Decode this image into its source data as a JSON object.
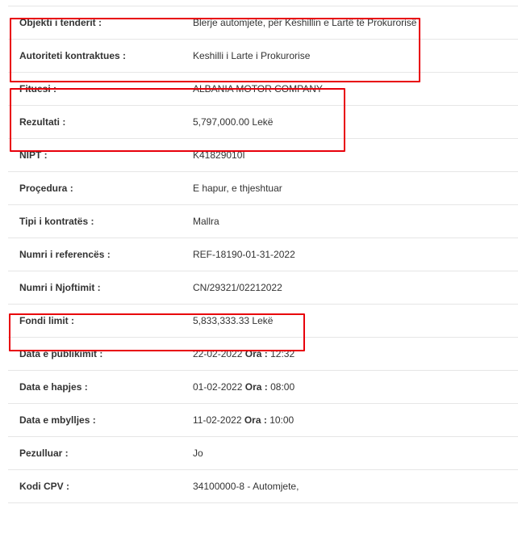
{
  "rows": [
    {
      "label": "Objekti i tenderit :",
      "value": "Blerje automjete, për Këshillin e Lartë të Prokurorisë"
    },
    {
      "label": "Autoriteti kontraktues :",
      "value": "Keshilli i Larte i Prokurorise"
    },
    {
      "label": "Fituesi :",
      "value": "ALBANIA MOTOR COMPANY"
    },
    {
      "label": "Rezultati :",
      "value": "5,797,000.00 Lekë"
    },
    {
      "label": "NIPT :",
      "value": "K41829010I"
    },
    {
      "label": "Proçedura :",
      "value": "E hapur, e thjeshtuar"
    },
    {
      "label": "Tipi i kontratës :",
      "value": "Mallra"
    },
    {
      "label": "Numri i referencës :",
      "value": "REF-18190-01-31-2022"
    },
    {
      "label": "Numri i Njoftimit :",
      "value": "CN/29321/02212022"
    },
    {
      "label": "Fondi limit :",
      "value": "5,833,333.33 Lekë"
    },
    {
      "label": "Data e publikimit :",
      "date": "22-02-2022",
      "time_label": "Ora :",
      "time": "12:32"
    },
    {
      "label": "Data e hapjes :",
      "date": "01-02-2022",
      "time_label": "Ora :",
      "time": "08:00"
    },
    {
      "label": "Data e mbylljes :",
      "date": "11-02-2022",
      "time_label": "Ora :",
      "time": "10:00"
    },
    {
      "label": "Pezulluar :",
      "value": "Jo"
    },
    {
      "label": "Kodi CPV :",
      "value": "34100000-8 - Automjete,"
    }
  ],
  "highlight_color": "#e8000b"
}
